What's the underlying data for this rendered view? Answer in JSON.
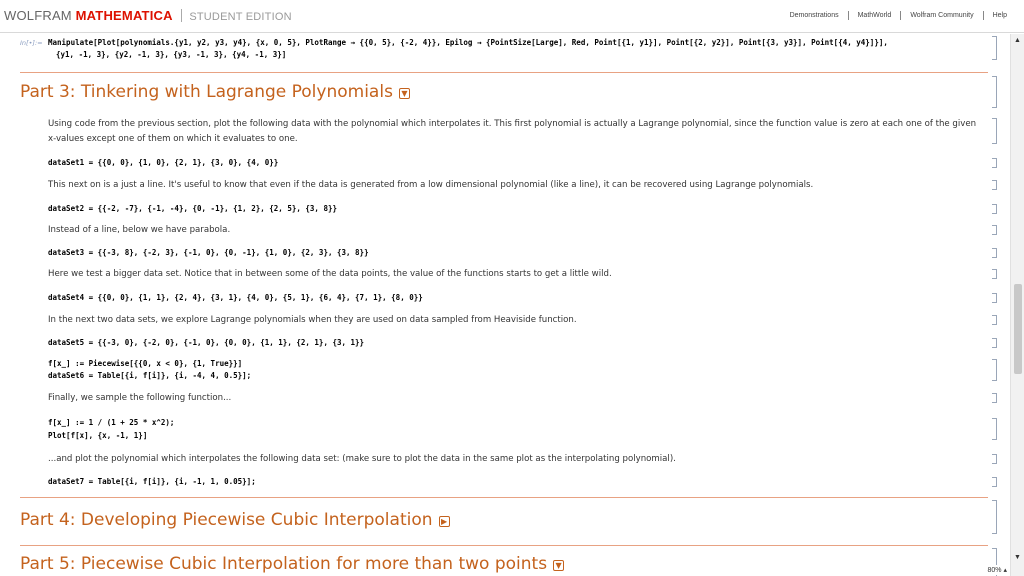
{
  "brand": {
    "name1": "WOLFRAM",
    "name2": "MATHEMATICA",
    "edition": "STUDENT EDITION"
  },
  "toplinks": [
    "Demonstrations",
    "MathWorld",
    "Wolfram Community",
    "Help"
  ],
  "input_label": "In[•]:=",
  "prev_code": {
    "line1": "Manipulate[Plot[polynomials.{y1, y2, y3, y4}, {x, 0, 5}, PlotRange → {{0, 5}, {-2, 4}}, Epilog → {PointSize[Large], Red, Point[{1, y1}], Point[{2, y2}], Point[{3, y3}], Point[{4, y4}]}],",
    "line2": "{y1, -1, 3}, {y2, -1, 3}, {y3, -1, 3}, {y4, -1, 3}]"
  },
  "part3": {
    "title": "Part 3: Tinkering with Lagrange Polynomials",
    "intro": "Using code from the previous section, plot the following data with the polynomial which interpolates it. This first polynomial is actually a Lagrange polynomial, since the function value is zero at each one of the given x-values except one of them on which it evaluates to one.",
    "ds1": "dataSet1 = {{0, 0}, {1, 0}, {2, 1}, {3, 0}, {4, 0}}",
    "t2": "This next on is a just a line. It's useful to know that even if the data is generated from a low dimensional polynomial (like a line), it can be recovered using Lagrange polynomials.",
    "ds2": "dataSet2 = {{-2, -7}, {-1, -4}, {0, -1}, {1, 2}, {2, 5}, {3, 8}}",
    "t3": "Instead of a line, below we have parabola.",
    "ds3": "dataSet3 = {{-3, 8}, {-2, 3}, {-1, 0}, {0, -1}, {1, 0}, {2, 3}, {3, 8}}",
    "t4": "Here we test a bigger data set. Notice that in between some of the data points, the value of the functions starts to get a little wild.",
    "ds4": "dataSet4 = {{0, 0}, {1, 1}, {2, 4}, {3, 1}, {4, 0}, {5, 1}, {6, 4}, {7, 1}, {8, 0}}",
    "t5": "In the next two data sets, we explore Lagrange polynomials when they are used on data sampled from Heaviside function.",
    "ds5": "dataSet5 = {{-3, 0}, {-2, 0}, {-1, 0}, {0, 0}, {1, 1}, {2, 1}, {3, 1}}",
    "f_def": "f[x_] := Piecewise[{{0, x < 0}, {1, True}}]",
    "ds6": "dataSet6 = Table[{i, f[i]}, {i, -4, 4, 0.5}];",
    "t6": "Finally, we sample the following function...",
    "f2": "f[x_] := 1 / (1 + 25 * x^2);",
    "plot": "Plot[f[x], {x, -1, 1}]",
    "t7": "...and plot the polynomial which interpolates the following data set: (make sure to plot the data in the same plot as the interpolating polynomial).",
    "ds7": "dataSet7 = Table[{i, f[i]}, {i, -1, 1, 0.05}];"
  },
  "part4": {
    "title": "Part 4: Developing Piecewise Cubic Interpolation"
  },
  "part5": {
    "title": "Part 5: Piecewise Cubic Interpolation for more than two points"
  },
  "zoom": "80%",
  "colors": {
    "section": "#c4621d",
    "rule": "#e8a283",
    "brand_red": "#dd1100",
    "var_blue": "#3b56b0"
  }
}
